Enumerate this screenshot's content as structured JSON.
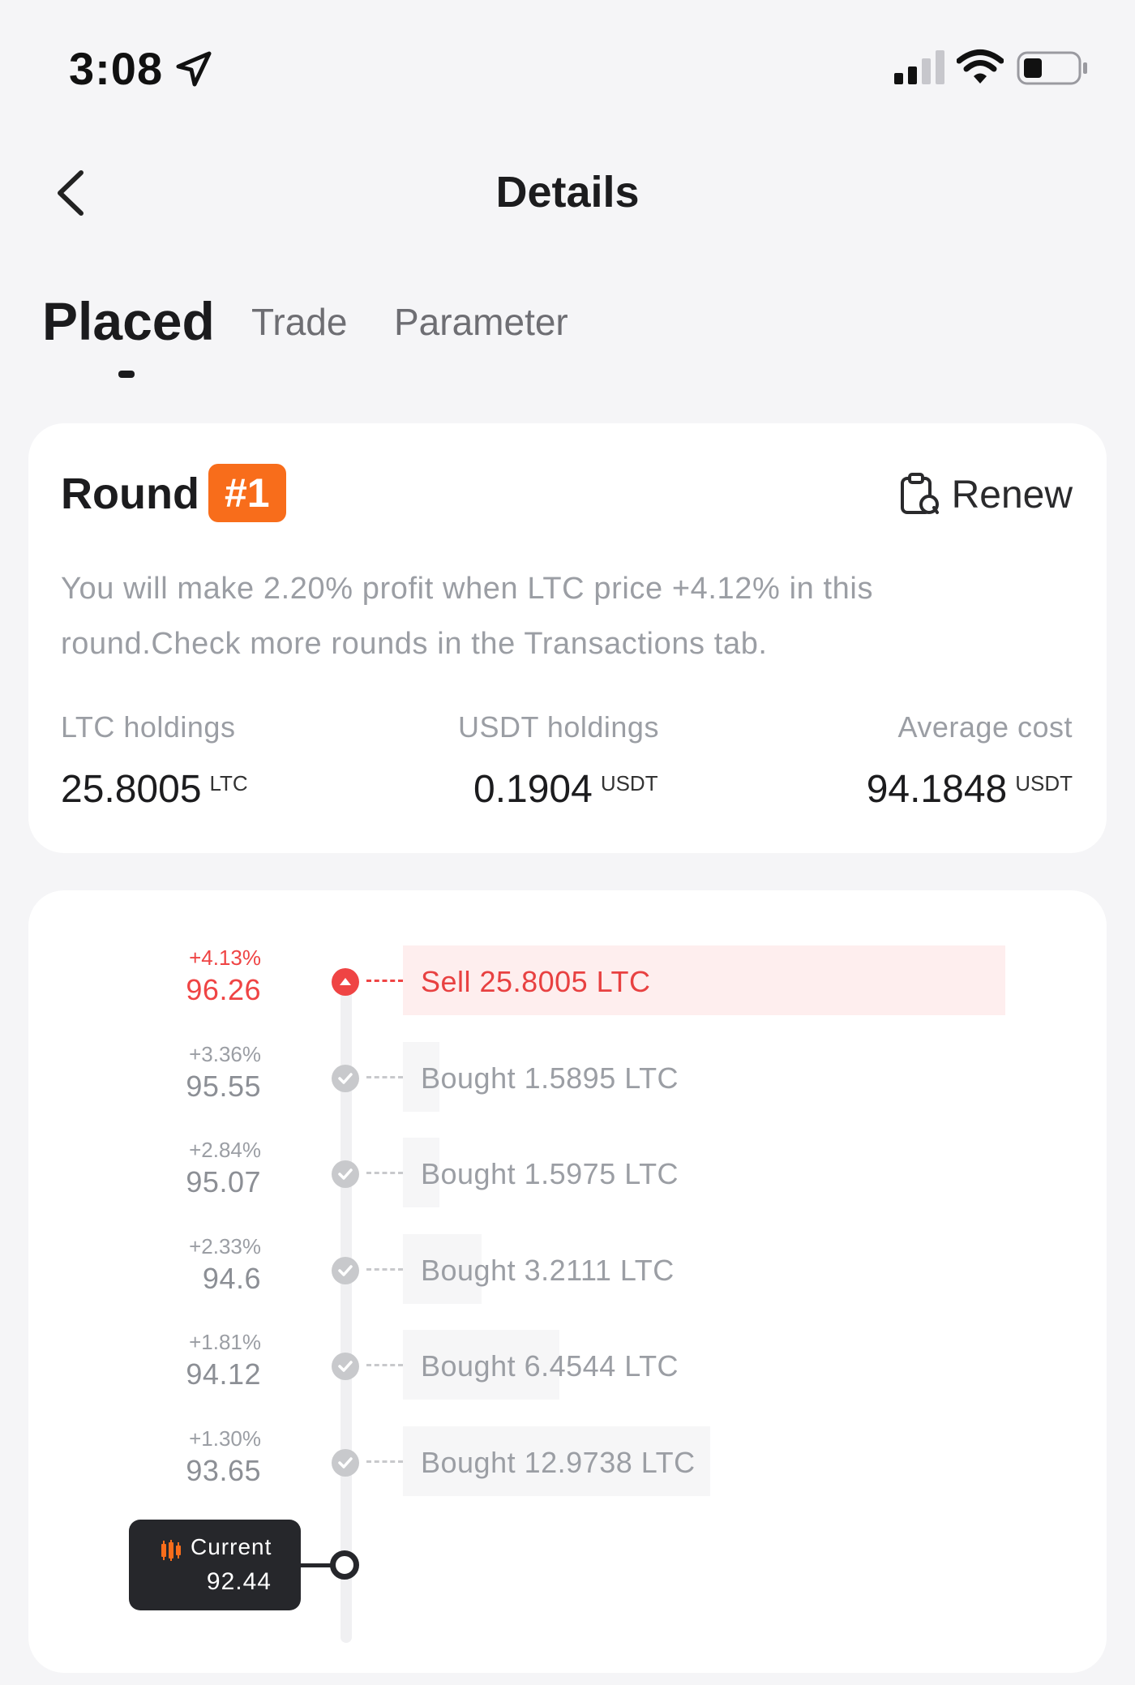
{
  "status_bar": {
    "time": "3:08"
  },
  "header": {
    "title": "Details"
  },
  "tabs": [
    {
      "label": "Placed"
    },
    {
      "label": "Trade"
    },
    {
      "label": "Parameter"
    }
  ],
  "round": {
    "label": "Round",
    "number": "#1",
    "renew_label": "Renew",
    "description": "You will make 2.20% profit when LTC price +4.12% in this round.Check more rounds in the Transactions tab.",
    "stats": [
      {
        "label": "LTC holdings",
        "value": "25.8005",
        "unit": "LTC"
      },
      {
        "label": "USDT holdings",
        "value": "0.1904",
        "unit": "USDT"
      },
      {
        "label": "Average cost",
        "value": "94.1848",
        "unit": "USDT"
      }
    ]
  },
  "ladder": {
    "levels": [
      {
        "pct": "+4.13%",
        "price": "96.26",
        "text": "Sell 25.8005 LTC",
        "type": "sell",
        "fill": 1.0
      },
      {
        "pct": "+3.36%",
        "price": "95.55",
        "text": "Bought 1.5895 LTC",
        "type": "bought",
        "fill": 0.06
      },
      {
        "pct": "+2.84%",
        "price": "95.07",
        "text": "Bought 1.5975 LTC",
        "type": "bought",
        "fill": 0.06
      },
      {
        "pct": "+2.33%",
        "price": "94.6",
        "text": "Bought 3.2111 LTC",
        "type": "bought",
        "fill": 0.13
      },
      {
        "pct": "+1.81%",
        "price": "94.12",
        "text": "Bought 6.4544 LTC",
        "type": "bought",
        "fill": 0.26
      },
      {
        "pct": "+1.30%",
        "price": "93.65",
        "text": "Bought 12.9738 LTC",
        "type": "bought",
        "fill": 0.51
      }
    ],
    "current": {
      "label": "Current",
      "value": "92.44"
    }
  },
  "colors": {
    "accent": "#f86d1b",
    "sell": "#ef4444",
    "muted": "#9b9ea4",
    "dark": "#26272b"
  },
  "icons": [
    "location-arrow-icon",
    "cellular-signal-icon",
    "wifi-icon",
    "battery-icon",
    "back-chevron-icon",
    "renew-clipboard-icon",
    "sell-up-arrow-icon",
    "checkmark-icon",
    "candlestick-icon"
  ]
}
